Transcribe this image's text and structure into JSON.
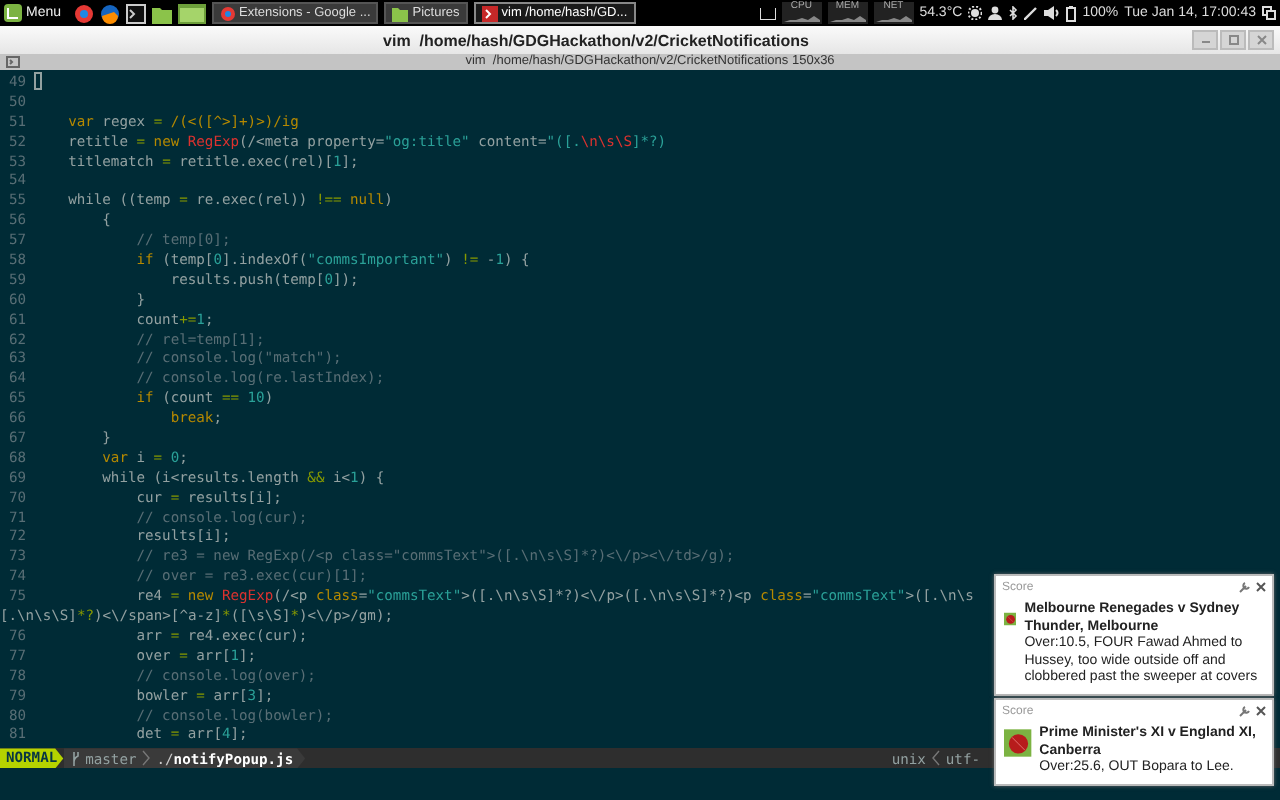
{
  "panel": {
    "menu_label": "Menu",
    "tasks": [
      {
        "label": "Extensions - Google ...",
        "kind": "browser",
        "selected": false
      },
      {
        "label": "Pictures",
        "kind": "folder",
        "selected": false
      },
      {
        "label": "vim /home/hash/GD...",
        "kind": "terminal",
        "selected": true
      }
    ],
    "monitors": [
      {
        "label": "CPU"
      },
      {
        "label": "MEM"
      },
      {
        "label": "NET"
      }
    ],
    "temperature": "54.3°C",
    "battery": "100%",
    "clock": "Tue Jan 14, 17:00:43"
  },
  "window": {
    "title": "vim  /home/hash/GDGHackathon/v2/CricketNotifications",
    "subtitle": "vim  /home/hash/GDGHackathon/v2/CricketNotifications 150x36"
  },
  "editor": {
    "lines": [
      {
        "number": "49",
        "cursor": true
      },
      {
        "number": "50",
        "cursor": false
      },
      {
        "number": "51",
        "cursor": false,
        "segments": [
          {
            "text": "    var",
            "kind": "keyword"
          },
          {
            "text": " regex ",
            "kind": "plain"
          },
          {
            "text": "=",
            "kind": "operator"
          },
          {
            "text": " /(<([^>]+)>)/ig",
            "kind": "keyword"
          }
        ]
      },
      {
        "number": "52",
        "cursor": false,
        "segments": [
          {
            "text": "    retitle ",
            "kind": "plain"
          },
          {
            "text": "=",
            "kind": "operator"
          },
          {
            "text": " new ",
            "kind": "keyword"
          },
          {
            "text": "RegExp",
            "kind": "special"
          },
          {
            "text": "(/<meta property=",
            "kind": "plain"
          },
          {
            "text": "\"og:title\"",
            "kind": "string"
          },
          {
            "text": " content=",
            "kind": "plain"
          },
          {
            "text": "\"([.",
            "kind": "string"
          },
          {
            "text": "\\n\\s\\S",
            "kind": "special"
          },
          {
            "text": "]*?)",
            "kind": "string"
          }
        ]
      },
      {
        "number": "53",
        "cursor": false,
        "segments": [
          {
            "text": "    titlematch ",
            "kind": "plain"
          },
          {
            "text": "=",
            "kind": "operator"
          },
          {
            "text": " retitle.exec(rel)[",
            "kind": "plain"
          },
          {
            "text": "1",
            "kind": "number"
          },
          {
            "text": "];",
            "kind": "plain"
          }
        ]
      },
      {
        "number": "54",
        "cursor": false
      },
      {
        "number": "55",
        "cursor": false,
        "segments": [
          {
            "text": "    while ((temp ",
            "kind": "plain"
          },
          {
            "text": "=",
            "kind": "operator"
          },
          {
            "text": " re.exec(rel)) ",
            "kind": "plain"
          },
          {
            "text": "!==",
            "kind": "operator"
          },
          {
            "text": " null",
            "kind": "keyword"
          },
          {
            "text": ")",
            "kind": "plain"
          }
        ]
      },
      {
        "number": "56",
        "cursor": false,
        "segments": [
          {
            "text": "        {",
            "kind": "plain"
          }
        ]
      },
      {
        "number": "57",
        "cursor": false,
        "segments": [
          {
            "text": "            // temp[0];",
            "kind": "comment"
          }
        ]
      },
      {
        "number": "58",
        "cursor": false,
        "segments": [
          {
            "text": "            if",
            "kind": "keyword"
          },
          {
            "text": " (temp[",
            "kind": "plain"
          },
          {
            "text": "0",
            "kind": "number"
          },
          {
            "text": "].indexOf(",
            "kind": "plain"
          },
          {
            "text": "\"commsImportant\"",
            "kind": "string"
          },
          {
            "text": ") ",
            "kind": "plain"
          },
          {
            "text": "!=",
            "kind": "operator"
          },
          {
            "text": " -",
            "kind": "plain"
          },
          {
            "text": "1",
            "kind": "number"
          },
          {
            "text": ") {",
            "kind": "plain"
          }
        ]
      },
      {
        "number": "59",
        "cursor": false,
        "segments": [
          {
            "text": "                results.push(temp[",
            "kind": "plain"
          },
          {
            "text": "0",
            "kind": "number"
          },
          {
            "text": "]);",
            "kind": "plain"
          }
        ]
      },
      {
        "number": "60",
        "cursor": false,
        "segments": [
          {
            "text": "            }",
            "kind": "plain"
          }
        ]
      },
      {
        "number": "61",
        "cursor": false,
        "segments": [
          {
            "text": "            count",
            "kind": "plain"
          },
          {
            "text": "+=",
            "kind": "operator"
          },
          {
            "text": "1",
            "kind": "number"
          },
          {
            "text": ";",
            "kind": "plain"
          }
        ]
      },
      {
        "number": "62",
        "cursor": false,
        "segments": [
          {
            "text": "            // rel=temp[1];",
            "kind": "comment"
          }
        ]
      },
      {
        "number": "63",
        "cursor": false,
        "segments": [
          {
            "text": "            // console.log(\"match\");",
            "kind": "comment"
          }
        ]
      },
      {
        "number": "64",
        "cursor": false,
        "segments": [
          {
            "text": "            // console.log(re.lastIndex);",
            "kind": "comment"
          }
        ]
      },
      {
        "number": "65",
        "cursor": false,
        "segments": [
          {
            "text": "            if",
            "kind": "keyword"
          },
          {
            "text": " (count ",
            "kind": "plain"
          },
          {
            "text": "==",
            "kind": "operator"
          },
          {
            "text": " 10",
            "kind": "number"
          },
          {
            "text": ")",
            "kind": "plain"
          }
        ]
      },
      {
        "number": "66",
        "cursor": false,
        "segments": [
          {
            "text": "                break",
            "kind": "keyword"
          },
          {
            "text": ";",
            "kind": "plain"
          }
        ]
      },
      {
        "number": "67",
        "cursor": false,
        "segments": [
          {
            "text": "        }",
            "kind": "plain"
          }
        ]
      },
      {
        "number": "68",
        "cursor": false,
        "segments": [
          {
            "text": "        var",
            "kind": "keyword"
          },
          {
            "text": " i ",
            "kind": "plain"
          },
          {
            "text": "=",
            "kind": "operator"
          },
          {
            "text": " 0",
            "kind": "number"
          },
          {
            "text": ";",
            "kind": "plain"
          }
        ]
      },
      {
        "number": "69",
        "cursor": false,
        "segments": [
          {
            "text": "        while (i<results.length ",
            "kind": "plain"
          },
          {
            "text": "&&",
            "kind": "operator"
          },
          {
            "text": " i<",
            "kind": "plain"
          },
          {
            "text": "1",
            "kind": "number"
          },
          {
            "text": ") {",
            "kind": "plain"
          }
        ]
      },
      {
        "number": "70",
        "cursor": false,
        "segments": [
          {
            "text": "            cur ",
            "kind": "plain"
          },
          {
            "text": "=",
            "kind": "operator"
          },
          {
            "text": " results[i];",
            "kind": "plain"
          }
        ]
      },
      {
        "number": "71",
        "cursor": false,
        "segments": [
          {
            "text": "            // console.log(cur);",
            "kind": "comment"
          }
        ]
      },
      {
        "number": "72",
        "cursor": false,
        "segments": [
          {
            "text": "            results[i];",
            "kind": "plain"
          }
        ]
      },
      {
        "number": "73",
        "cursor": false,
        "segments": [
          {
            "text": "            // re3 = new RegExp(/<p class=\"commsText\">([.\\n\\s\\S]*?)<\\/p><\\/td>/g);",
            "kind": "comment"
          }
        ]
      },
      {
        "number": "74",
        "cursor": false,
        "segments": [
          {
            "text": "            // over = re3.exec(cur)[1];",
            "kind": "comment"
          }
        ]
      },
      {
        "number": "75",
        "cursor": false,
        "segments": [
          {
            "text": "            re4 ",
            "kind": "plain"
          },
          {
            "text": "=",
            "kind": "operator"
          },
          {
            "text": " new ",
            "kind": "keyword"
          },
          {
            "text": "RegExp",
            "kind": "special"
          },
          {
            "text": "(/<p ",
            "kind": "plain"
          },
          {
            "text": "class",
            "kind": "keyword"
          },
          {
            "text": "=",
            "kind": "plain"
          },
          {
            "text": "\"commsText\"",
            "kind": "string"
          },
          {
            "text": ">([.\\n\\s\\S]*?)<\\/p>([.\\n\\s\\S]*?)<p ",
            "kind": "plain"
          },
          {
            "text": "class",
            "kind": "keyword"
          },
          {
            "text": "=",
            "kind": "plain"
          },
          {
            "text": "\"commsText\"",
            "kind": "string"
          },
          {
            "text": ">([.\\n\\s",
            "kind": "plain"
          }
        ],
        "continuation": [
          {
            "text": "[.\\n\\s\\S]",
            "kind": "plain"
          },
          {
            "text": "*?",
            "kind": "operator"
          },
          {
            "text": ")<\\/span>[^a-z]",
            "kind": "plain"
          },
          {
            "text": "*",
            "kind": "operator"
          },
          {
            "text": "([\\s\\S]",
            "kind": "plain"
          },
          {
            "text": "*",
            "kind": "operator"
          },
          {
            "text": ")<\\/p>/gm);",
            "kind": "plain"
          }
        ]
      },
      {
        "number": "76",
        "cursor": false,
        "segments": [
          {
            "text": "            arr ",
            "kind": "plain"
          },
          {
            "text": "=",
            "kind": "operator"
          },
          {
            "text": " re4.exec(cur);",
            "kind": "plain"
          }
        ]
      },
      {
        "number": "77",
        "cursor": false,
        "segments": [
          {
            "text": "            over ",
            "kind": "plain"
          },
          {
            "text": "=",
            "kind": "operator"
          },
          {
            "text": " arr[",
            "kind": "plain"
          },
          {
            "text": "1",
            "kind": "number"
          },
          {
            "text": "];",
            "kind": "plain"
          }
        ]
      },
      {
        "number": "78",
        "cursor": false,
        "segments": [
          {
            "text": "            // console.log(over);",
            "kind": "comment"
          }
        ]
      },
      {
        "number": "79",
        "cursor": false,
        "segments": [
          {
            "text": "            bowler ",
            "kind": "plain"
          },
          {
            "text": "=",
            "kind": "operator"
          },
          {
            "text": " arr[",
            "kind": "plain"
          },
          {
            "text": "3",
            "kind": "number"
          },
          {
            "text": "];",
            "kind": "plain"
          }
        ]
      },
      {
        "number": "80",
        "cursor": false,
        "segments": [
          {
            "text": "            // console.log(bowler);",
            "kind": "comment"
          }
        ]
      },
      {
        "number": "81",
        "cursor": false,
        "segments": [
          {
            "text": "            det ",
            "kind": "plain"
          },
          {
            "text": "=",
            "kind": "operator"
          },
          {
            "text": " arr[",
            "kind": "plain"
          },
          {
            "text": "4",
            "kind": "number"
          },
          {
            "text": "];",
            "kind": "plain"
          }
        ]
      }
    ],
    "statusline": {
      "mode": "NORMAL",
      "branch": "master",
      "file": "./**notifyPopup.js**",
      "format": "unix",
      "encoding": "utf-"
    }
  },
  "notifications": [
    {
      "source": "Score",
      "title": "Melbourne Renegades v Sydney Thunder, Melbourne",
      "text": "Over:10.5, FOUR Fawad Ahmed to Hussey, too wide outside off and clobbered past the sweeper at covers"
    },
    {
      "source": "Score",
      "title": "Prime Minister's XI v England XI, Canberra",
      "text": "Over:25.6, OUT Bopara to Lee."
    }
  ]
}
